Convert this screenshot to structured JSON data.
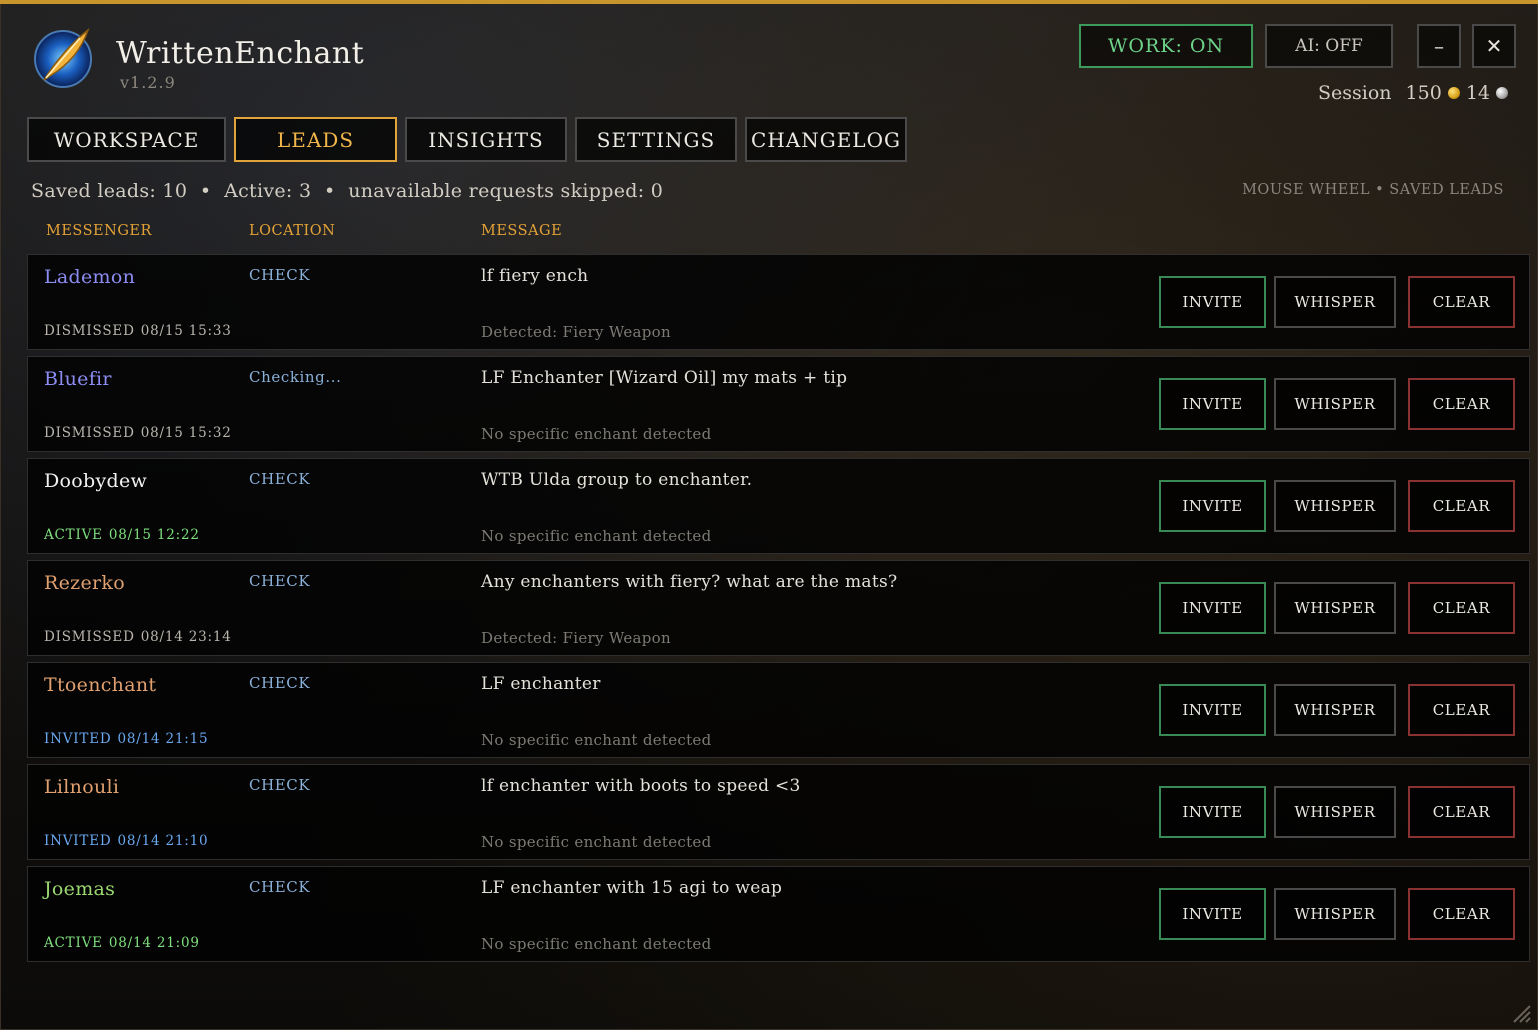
{
  "app": {
    "title": "WrittenEnchant",
    "version": "v1.2.9"
  },
  "controls": {
    "work": "WORK: ON",
    "ai": "AI: OFF",
    "minimize": "–",
    "close": "✕"
  },
  "session": {
    "label": "Session",
    "gold": "150",
    "silver": "14"
  },
  "tabs": [
    "WORKSPACE",
    "LEADS",
    "INSIGHTS",
    "SETTINGS",
    "CHANGELOG"
  ],
  "active_tab": "LEADS",
  "summary": {
    "text": "Saved leads: 10  •  Active: 3  •  unavailable requests skipped: 0"
  },
  "hint": "MOUSE WHEEL • SAVED LEADS",
  "columns": {
    "messenger": "MESSENGER",
    "location": "LOCATION",
    "message": "MESSAGE"
  },
  "actions": {
    "invite": "INVITE",
    "whisper": "WHISPER",
    "clear": "CLEAR"
  },
  "colors": {
    "accent": "#e3a236",
    "work_on": "#6ed48a",
    "status_dismissed": "#b9b5ad",
    "status_active": "#7ee07e",
    "status_invited": "#6aa8f0"
  },
  "leads": [
    {
      "name": "Lademon",
      "name_color": "#8c8cf2",
      "location": "CHECK",
      "message": "lf fiery ench",
      "detected": "Detected: Fiery Weapon",
      "status": "DISMISSED",
      "status_color": "#b9b5ad",
      "time": "08/15 15:33"
    },
    {
      "name": "Bluefir",
      "name_color": "#8c8cf2",
      "location": "Checking...",
      "message": "LF Enchanter [Wizard Oil] my mats + tip",
      "detected": "No specific enchant detected",
      "status": "DISMISSED",
      "status_color": "#b9b5ad",
      "time": "08/15 15:32"
    },
    {
      "name": "Doobydew",
      "name_color": "#f2f2f2",
      "location": "CHECK",
      "message": "WTB Ulda group to enchanter.",
      "detected": "No specific enchant detected",
      "status": "ACTIVE",
      "status_color": "#7ee07e",
      "time": "08/15 12:22"
    },
    {
      "name": "Rezerko",
      "name_color": "#e0a070",
      "location": "CHECK",
      "message": "Any enchanters with fiery? what are the mats?",
      "detected": "Detected: Fiery Weapon",
      "status": "DISMISSED",
      "status_color": "#b9b5ad",
      "time": "08/14 23:14"
    },
    {
      "name": "Ttoenchant",
      "name_color": "#e0a070",
      "location": "CHECK",
      "message": "LF enchanter",
      "detected": "No specific enchant detected",
      "status": "INVITED",
      "status_color": "#6aa8f0",
      "time": "08/14 21:15"
    },
    {
      "name": "Lilnouli",
      "name_color": "#e0a070",
      "location": "CHECK",
      "message": "lf enchanter with boots to speed <3",
      "detected": "No specific enchant detected",
      "status": "INVITED",
      "status_color": "#6aa8f0",
      "time": "08/14 21:10"
    },
    {
      "name": "Joemas",
      "name_color": "#9ad870",
      "location": "CHECK",
      "message": "LF enchanter with 15 agi to weap",
      "detected": "No specific enchant detected",
      "status": "ACTIVE",
      "status_color": "#7ee07e",
      "time": "08/14 21:09"
    }
  ]
}
